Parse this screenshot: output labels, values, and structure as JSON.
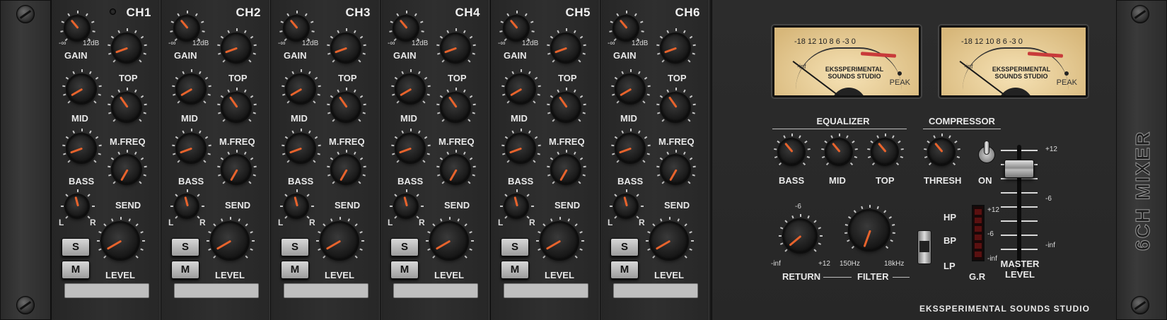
{
  "channels": [
    {
      "title": "CH1",
      "gain": "GAIN",
      "top": "TOP",
      "mid": "MID",
      "mfreq": "M.FREQ",
      "bass": "BASS",
      "send": "SEND",
      "level": "LEVEL",
      "solo": "S",
      "mute": "M",
      "gain_min": "-∞",
      "gain_max": "12dB",
      "pan_l": "L",
      "pan_r": "R"
    },
    {
      "title": "CH2",
      "gain": "GAIN",
      "top": "TOP",
      "mid": "MID",
      "mfreq": "M.FREQ",
      "bass": "BASS",
      "send": "SEND",
      "level": "LEVEL",
      "solo": "S",
      "mute": "M",
      "gain_min": "-∞",
      "gain_max": "12dB",
      "pan_l": "L",
      "pan_r": "R"
    },
    {
      "title": "CH3",
      "gain": "GAIN",
      "top": "TOP",
      "mid": "MID",
      "mfreq": "M.FREQ",
      "bass": "BASS",
      "send": "SEND",
      "level": "LEVEL",
      "solo": "S",
      "mute": "M",
      "gain_min": "-∞",
      "gain_max": "12dB",
      "pan_l": "L",
      "pan_r": "R"
    },
    {
      "title": "CH4",
      "gain": "GAIN",
      "top": "TOP",
      "mid": "MID",
      "mfreq": "M.FREQ",
      "bass": "BASS",
      "send": "SEND",
      "level": "LEVEL",
      "solo": "S",
      "mute": "M",
      "gain_min": "-∞",
      "gain_max": "12dB",
      "pan_l": "L",
      "pan_r": "R"
    },
    {
      "title": "CH5",
      "gain": "GAIN",
      "top": "TOP",
      "mid": "MID",
      "mfreq": "M.FREQ",
      "bass": "BASS",
      "send": "SEND",
      "level": "LEVEL",
      "solo": "S",
      "mute": "M",
      "gain_min": "-∞",
      "gain_max": "12dB",
      "pan_l": "L",
      "pan_r": "R"
    },
    {
      "title": "CH6",
      "gain": "GAIN",
      "top": "TOP",
      "mid": "MID",
      "mfreq": "M.FREQ",
      "bass": "BASS",
      "send": "SEND",
      "level": "LEVEL",
      "solo": "S",
      "mute": "M",
      "gain_min": "-∞",
      "gain_max": "12dB",
      "pan_l": "L",
      "pan_r": "R"
    }
  ],
  "vu_meters": [
    {
      "scale": "-18  12 10  8  6   -3   0",
      "inf": "-inf",
      "brand_line1": "EKSSPERIMENTAL",
      "brand_line2": "SOUNDS STUDIO",
      "peak": "PEAK"
    },
    {
      "scale": "-18  12 10  8  6   -3   0",
      "inf": "-inf",
      "brand_line1": "EKSSPERIMENTAL",
      "brand_line2": "SOUNDS STUDIO",
      "peak": "PEAK"
    }
  ],
  "master": {
    "equalizer_title": "EQUALIZER",
    "compressor_title": "COMPRESSOR",
    "eq_bass": "BASS",
    "eq_mid": "MID",
    "eq_top": "TOP",
    "thresh": "THRESH",
    "on": "ON",
    "return": "RETURN",
    "return_min": "-inf",
    "return_max": "+12",
    "return_mid": "-6",
    "filter": "FILTER",
    "filter_min": "150Hz",
    "filter_max": "18kHz",
    "hp": "HP",
    "bp": "BP",
    "lp": "LP",
    "gr": "G.R",
    "gr_plus12": "+12",
    "gr_minus6": "-6",
    "gr_inf": "-inf",
    "fader_plus12": "+12",
    "fader_minus6": "-6",
    "fader_inf": "-inf",
    "master_level_line1": "MASTER",
    "master_level_line2": "LEVEL",
    "brand": "EKSSPERIMENTAL SOUNDS STUDIO"
  },
  "rack_brand": "6CH MIXER",
  "accent_color": "#e8632c"
}
